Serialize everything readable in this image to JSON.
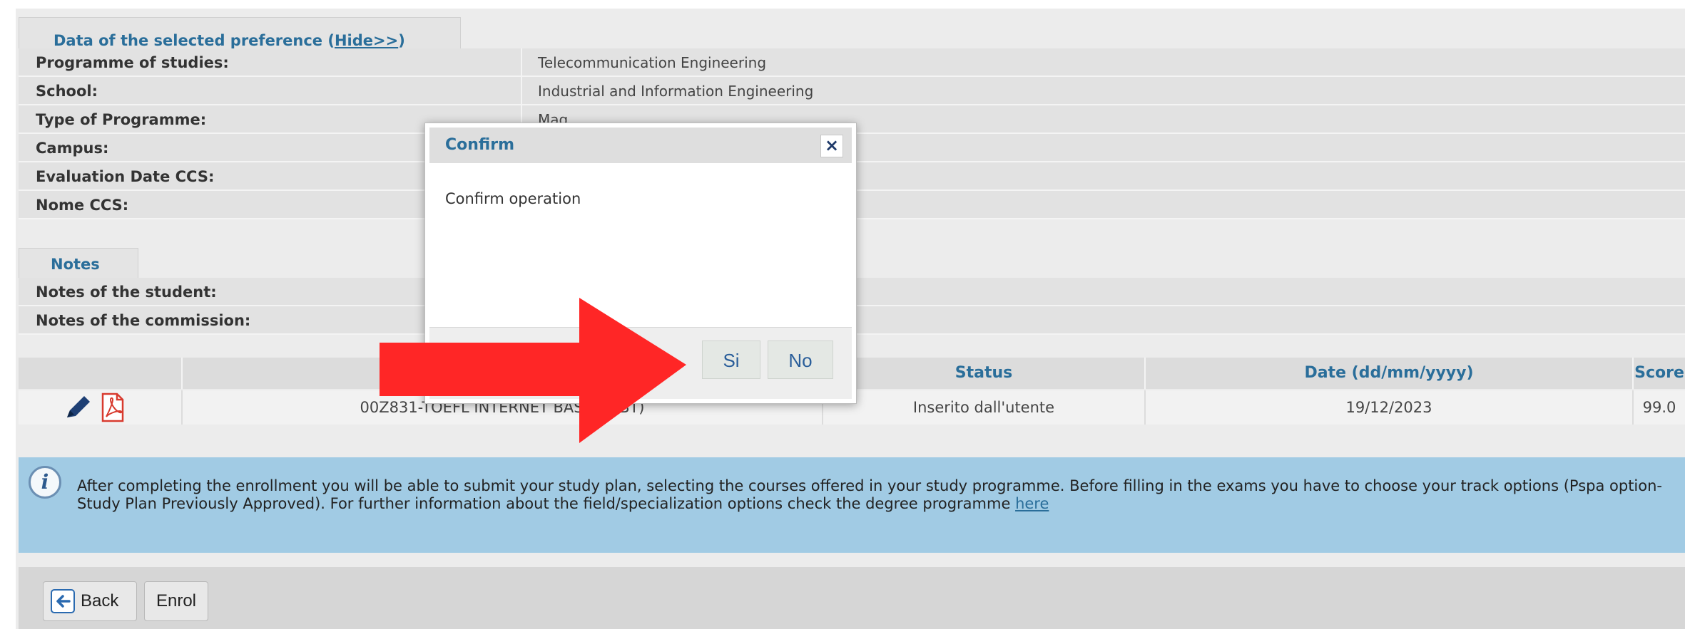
{
  "preference_section": {
    "title": "Data of the selected preference (",
    "hide_link": "Hide>>",
    "title_end": ")",
    "rows": [
      {
        "label": "Programme of studies:",
        "value": "Telecommunication Engineering"
      },
      {
        "label": "School:",
        "value": "Industrial and Information Engineering"
      },
      {
        "label": "Type of Programme:",
        "value": "Mag"
      },
      {
        "label": "Campus:",
        "value": ""
      },
      {
        "label": "Evaluation Date CCS:",
        "value": ""
      },
      {
        "label": "Nome CCS:",
        "value": ""
      }
    ]
  },
  "notes_section": {
    "title": "Notes",
    "rows": [
      {
        "label": "Notes of the student:",
        "value": ""
      },
      {
        "label": "Notes of the commission:",
        "value": ""
      }
    ]
  },
  "tests_table": {
    "headers": [
      "",
      "",
      "Status",
      "Date (dd/mm/yyyy)",
      "Score"
    ],
    "row": {
      "test": "00Z831-TOEFL INTERNET BASED (IBT)",
      "status": "Inserito dall'utente",
      "date": "19/12/2023",
      "score": "99.0"
    },
    "icons": [
      "edit-pencil-icon",
      "pdf-icon"
    ]
  },
  "info_box": {
    "text": "After completing the enrollment you will be able to submit your study plan, selecting the courses offered in your study programme. Before filling in the exams you have to choose your track options (Pspa option- Study Plan Previously Approved). For further information about the field/specialization options check the degree programme ",
    "link": "here"
  },
  "footer": {
    "back_label": "Back",
    "enrol_label": "Enrol"
  },
  "dialog": {
    "title": "Confirm",
    "close": "×",
    "message": "Confirm operation",
    "yes_label": "Si",
    "no_label": "No"
  },
  "colors": {
    "accent_text": "#2a6e9a",
    "info_background": "#a1cbe4",
    "arrow": "#ff2626"
  }
}
